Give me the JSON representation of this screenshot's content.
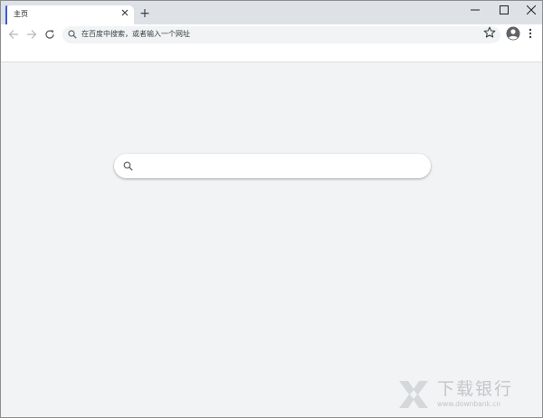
{
  "tab": {
    "title": "主页",
    "close_icon": "close-icon"
  },
  "tabstrip": {
    "new_tab_label": "+"
  },
  "window_controls": {
    "minimize": "minimize-icon",
    "maximize": "maximize-icon",
    "close": "close-icon"
  },
  "toolbar": {
    "omnibox_placeholder": "在百度中搜索，或者输入一个网址",
    "icons": [
      "back-arrow-icon",
      "forward-arrow-icon",
      "reload-icon",
      "search-icon",
      "star-icon",
      "profile-avatar-icon",
      "more-menu-icon"
    ]
  },
  "content": {
    "search_icon": "search-icon"
  },
  "watermark": {
    "title": "下载银行",
    "url": "www.downbank.cn"
  },
  "colors": {
    "tabstrip": "#dee1e6",
    "tab_accent": "#3b5bd6",
    "page_bg": "#f1f3f4",
    "omnibox_bg": "#f1f3f4",
    "watermark": "#c3c6ca"
  }
}
